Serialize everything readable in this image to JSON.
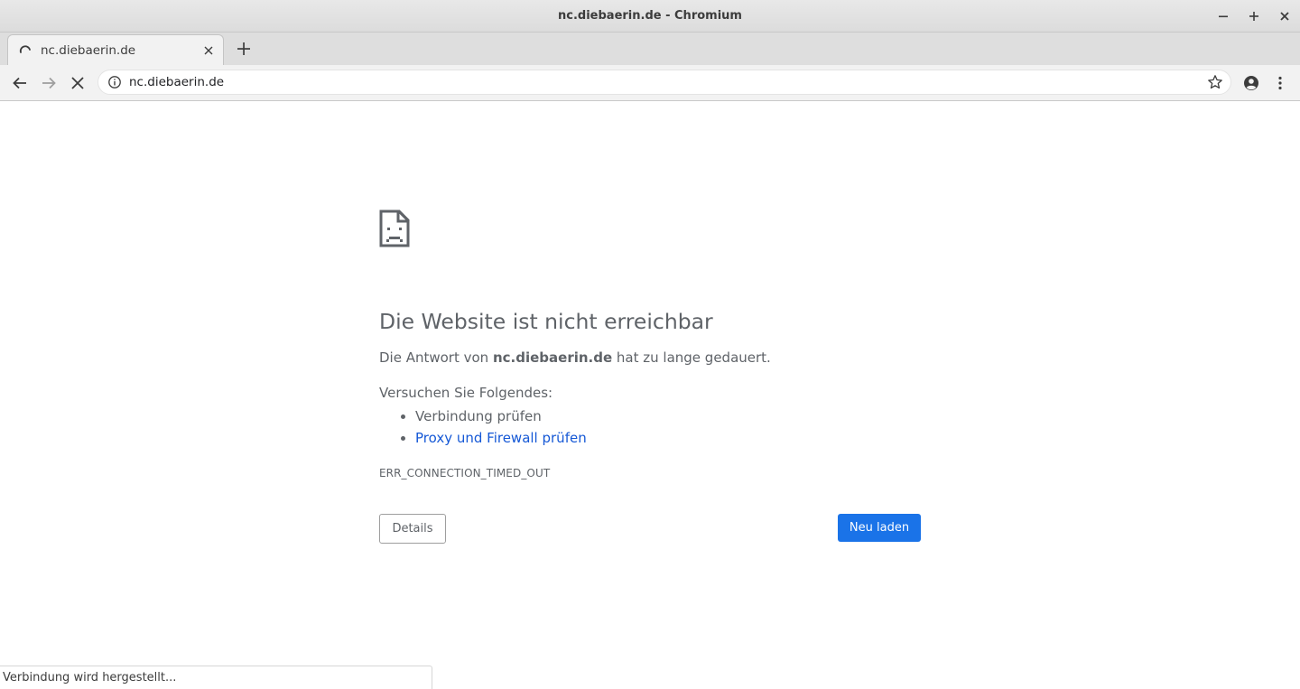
{
  "window": {
    "title": "nc.diebaerin.de - Chromium"
  },
  "tab": {
    "title": "nc.diebaerin.de"
  },
  "omnibox": {
    "url": "nc.diebaerin.de"
  },
  "error_page": {
    "heading": "Die Website ist nicht erreichbar",
    "desc_prefix": "Die Antwort von ",
    "desc_host": "nc.diebaerin.de",
    "desc_suffix": " hat zu lange gedauert.",
    "try_label": "Versuchen Sie Folgendes:",
    "suggestions": [
      {
        "label": "Verbindung prüfen",
        "link": false
      },
      {
        "label": "Proxy und Firewall prüfen",
        "link": true
      }
    ],
    "error_code": "ERR_CONNECTION_TIMED_OUT",
    "details_button": "Details",
    "reload_button": "Neu laden"
  },
  "status": {
    "text": "Verbindung wird hergestellt..."
  },
  "colors": {
    "accent": "#1a73e8",
    "link": "#1558d6",
    "text_muted": "#5f6368"
  },
  "icons": {
    "minimize": "minimize-icon",
    "maximize": "maximize-icon",
    "close": "close-icon",
    "back": "arrow-left-icon",
    "forward": "arrow-right-icon",
    "stop": "stop-x-icon",
    "info": "info-icon",
    "bookmark": "star-icon",
    "profile": "account-circle-icon",
    "menu": "three-dots-vertical-icon",
    "error": "sad-document-icon"
  }
}
